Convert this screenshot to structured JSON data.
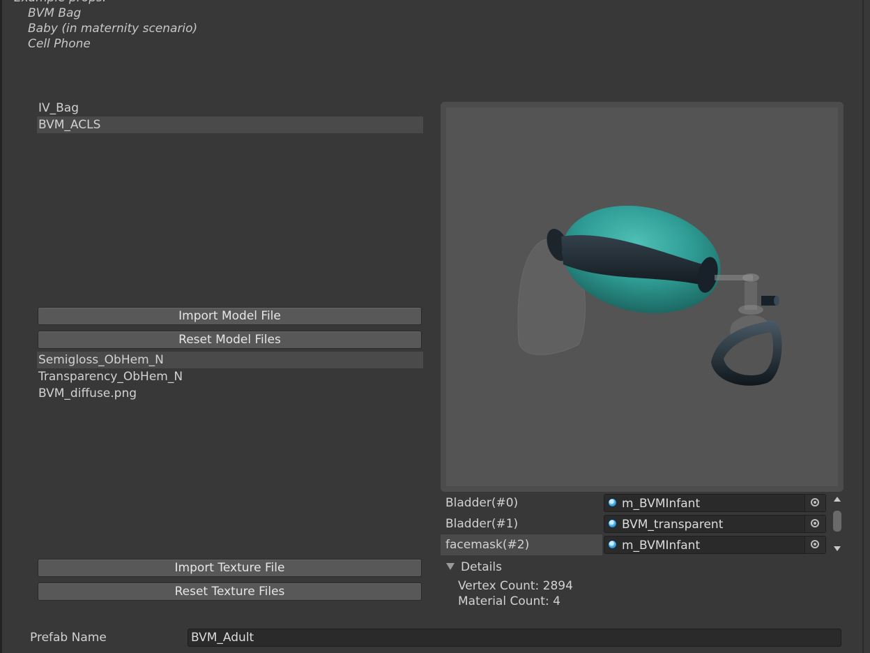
{
  "intro": {
    "heading": "Example props:",
    "items": [
      "BVM Bag",
      "Baby (in maternity scenario)",
      "Cell Phone"
    ]
  },
  "models": {
    "items": [
      {
        "label": "IV_Bag",
        "selected": false
      },
      {
        "label": "BVM_ACLS",
        "selected": true
      }
    ],
    "import_label": "Import Model File",
    "reset_label": "Reset Model Files"
  },
  "textures": {
    "items": [
      {
        "label": "Semigloss_ObHem_N",
        "selected": true
      },
      {
        "label": "Transparency_ObHem_N",
        "selected": false
      },
      {
        "label": "BVM_diffuse.png",
        "selected": false
      }
    ],
    "import_label": "Import Texture File",
    "reset_label": "Reset Texture Files"
  },
  "preview": {
    "colors": {
      "bag": "#2e9c94",
      "band": "#1e2a33",
      "background": "#545454"
    }
  },
  "materials": [
    {
      "slot": "Bladder(#0)",
      "material": "m_BVMInfant",
      "selected": false
    },
    {
      "slot": "Bladder(#1)",
      "material": "BVM_transparent",
      "selected": false
    },
    {
      "slot": "facemask(#2)",
      "material": "m_BVMInfant",
      "selected": true
    }
  ],
  "details": {
    "heading": "Details",
    "vertex_count": "Vertex Count: 2894",
    "material_count": "Material Count: 4"
  },
  "prefab": {
    "label": "Prefab Name",
    "value": "BVM_Adult"
  }
}
